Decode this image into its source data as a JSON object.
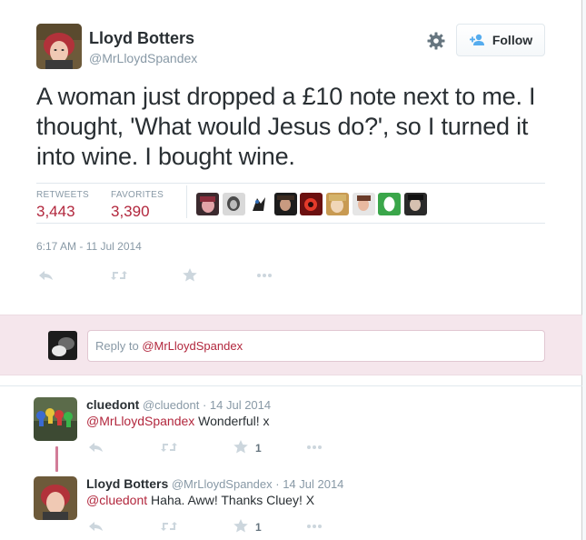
{
  "tweet": {
    "author_name": "Lloyd Botters",
    "author_handle": "@MrLloydSpandex",
    "follow_label": "Follow",
    "text": "A woman just dropped a £10 note next to me. I thought, 'What would Jesus do?', so I turned it into wine. I bought wine.",
    "retweets_label": "RETWEETS",
    "retweets_count": "3,443",
    "favorites_label": "FAVORITES",
    "favorites_count": "3,390",
    "timestamp": "6:17 AM - 11 Jul 2014"
  },
  "reply_box": {
    "prefix": "Reply to ",
    "mention": "@MrLloydSpandex"
  },
  "replies": [
    {
      "name": "cluedont",
      "handle": "@cluedont",
      "sep": " · ",
      "date": "14 Jul 2014",
      "mention": "@MrLloydSpandex",
      "text": " Wonderful! x",
      "fav_count": "1"
    },
    {
      "name": "Lloyd Botters",
      "handle": "@MrLloydSpandex",
      "sep": " · ",
      "date": "14 Jul 2014",
      "mention": "@cluedont",
      "text": " Haha. Aww! Thanks Cluey! X",
      "fav_count": "1"
    }
  ],
  "icons": [
    "gear-icon",
    "add-user-icon",
    "reply-icon",
    "retweet-icon",
    "favorite-star-icon",
    "more-dots-icon"
  ],
  "colors": {
    "accent": "#b2273d",
    "muted": "#8899a6",
    "reply_bg": "#f5e6ec",
    "thread_line": "#d27c98"
  }
}
